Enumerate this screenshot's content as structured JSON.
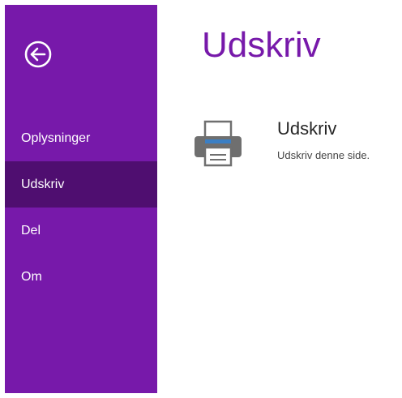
{
  "sidebar": {
    "back_icon": "back-arrow-circle-icon",
    "background_color": "#7719aa",
    "selected_color": "#4f0e70",
    "items": [
      {
        "label": "Oplysninger",
        "selected": false
      },
      {
        "label": "Udskriv",
        "selected": true
      },
      {
        "label": "Del",
        "selected": false
      },
      {
        "label": "Om",
        "selected": false
      }
    ]
  },
  "main": {
    "title": "Udskriv",
    "title_color": "#7719aa",
    "actions": [
      {
        "icon": "printer-icon",
        "title": "Udskriv",
        "description": "Udskriv denne side."
      }
    ]
  }
}
